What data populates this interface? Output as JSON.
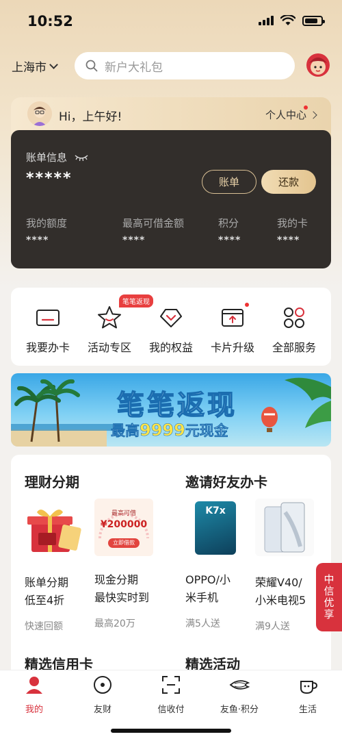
{
  "status": {
    "time": "10:52"
  },
  "header": {
    "city": "上海市",
    "search_placeholder": "新户大礼包"
  },
  "greeting": {
    "text": "Hi，上午好!",
    "center_link": "个人中心"
  },
  "bill": {
    "title": "账单信息",
    "amount_masked": "*****",
    "bill_button": "账单",
    "repay_button": "还款",
    "stats": [
      {
        "label": "我的额度",
        "value": "****"
      },
      {
        "label": "最高可借金额",
        "value": "****"
      },
      {
        "label": "积分",
        "value": "****"
      },
      {
        "label": "我的卡",
        "value": "****"
      }
    ]
  },
  "services": [
    {
      "label": "我要办卡",
      "icon": "card-icon"
    },
    {
      "label": "活动专区",
      "icon": "star-icon",
      "badge": "笔笔返现"
    },
    {
      "label": "我的权益",
      "icon": "gift-chevron-icon"
    },
    {
      "label": "卡片升级",
      "icon": "card-upgrade-icon"
    },
    {
      "label": "全部服务",
      "icon": "grid-icon"
    }
  ],
  "banner": {
    "title": "笔笔返现",
    "sub_prefix": "最高",
    "sub_amount": "9999",
    "sub_suffix": "元现金"
  },
  "sections": {
    "finance_title": "理财分期",
    "invite_title": "邀请好友办卡",
    "credit_card_title": "精选信用卡",
    "activity_title": "精选活动"
  },
  "products": [
    {
      "line1": "账单分期",
      "line2": "低至4折",
      "sub": "快速回额"
    },
    {
      "line1": "现金分期",
      "line2": "最快实时到",
      "sub": "最高20万",
      "img_text_top": "最高可借",
      "img_text_amount": "¥200000",
      "img_text_btn": "立即借款"
    },
    {
      "line1": "OPPO/小",
      "line2": "米手机",
      "sub": "满5人送",
      "img_text": "K7x"
    },
    {
      "line1": "荣耀V40/",
      "line2": "小米电视5",
      "sub": "满9人送"
    }
  ],
  "float_badge": "中信优享",
  "tabs": [
    {
      "label": "我的",
      "icon": "person-icon",
      "active": true
    },
    {
      "label": "友财",
      "icon": "coin-icon"
    },
    {
      "label": "信收付",
      "icon": "scan-icon"
    },
    {
      "label": "友鱼·积分",
      "icon": "fish-icon"
    },
    {
      "label": "生活",
      "icon": "cup-icon"
    }
  ],
  "colors": {
    "accent": "#d8323d",
    "gold": "#e3c48f",
    "card_dark": "#322e2b"
  }
}
